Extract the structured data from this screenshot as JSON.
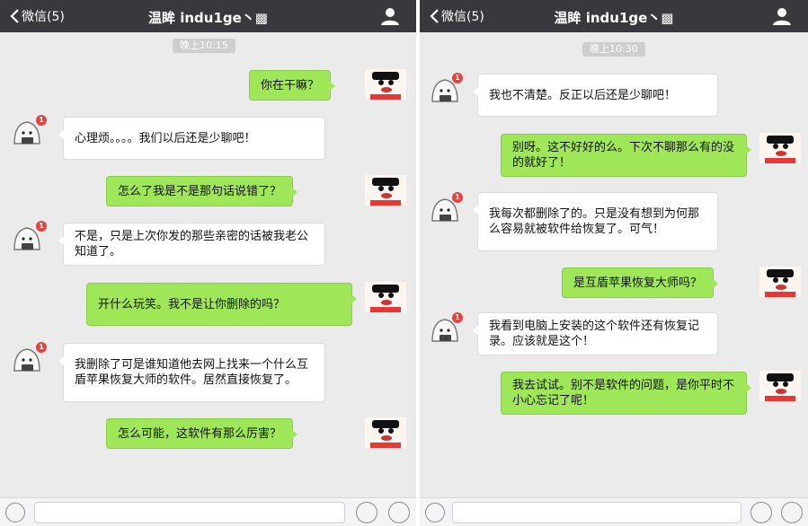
{
  "colors": {
    "nav_bg": "#39393d",
    "chat_bg": "#ebebeb",
    "bubble_out": "#9fe658",
    "bubble_in": "#ffffff",
    "badge": "#e64340"
  },
  "left": {
    "back_label": "微信(5)",
    "title": "温眸 indu1ge丶▩",
    "time": "晚上10:15",
    "messages": [
      {
        "side": "out",
        "text": "你在干嘛？"
      },
      {
        "side": "in",
        "text": "心理烦。。。。我们以后还是少聊吧！"
      },
      {
        "side": "out",
        "text": "怎么了我是不是那句话说错了？"
      },
      {
        "side": "in",
        "text": "不是，只是上次你发的那些亲密的话被我老公知道了。"
      },
      {
        "side": "out",
        "text": "开什么玩笑。我不是让你删除的吗？"
      },
      {
        "side": "in",
        "text": "我删除了可是谁知道他去网上找来一个什么互盾苹果恢复大师的软件。居然直接恢复了。"
      },
      {
        "side": "out",
        "text": "怎么可能，这软件有那么厉害？"
      }
    ]
  },
  "right": {
    "back_label": "微信(5)",
    "title": "温眸 indu1ge丶▩",
    "time": "晚上10:30",
    "messages": [
      {
        "side": "in",
        "text": "我也不清楚。反正以后还是少聊吧！"
      },
      {
        "side": "out",
        "text": "别呀。这不好好的么。下次不聊那么有的没的就好了！"
      },
      {
        "side": "in",
        "text": "我每次都删除了的。只是没有想到为何那么容易就被软件给恢复了。可气！"
      },
      {
        "side": "out",
        "text": "是互盾苹果恢复大师吗？"
      },
      {
        "side": "in",
        "text": "我看到电脑上安装的这个软件还有恢复记录。应该就是这个！"
      },
      {
        "side": "out",
        "text": "我去试试。别不是软件的问题，是你平时不小心忘记了呢！"
      }
    ]
  },
  "badge_count": "1",
  "icons": {
    "back": "chevron-left-icon",
    "user": "person-icon",
    "voice": "voice-icon",
    "emoji": "emoji-icon",
    "plus": "plus-icon"
  }
}
